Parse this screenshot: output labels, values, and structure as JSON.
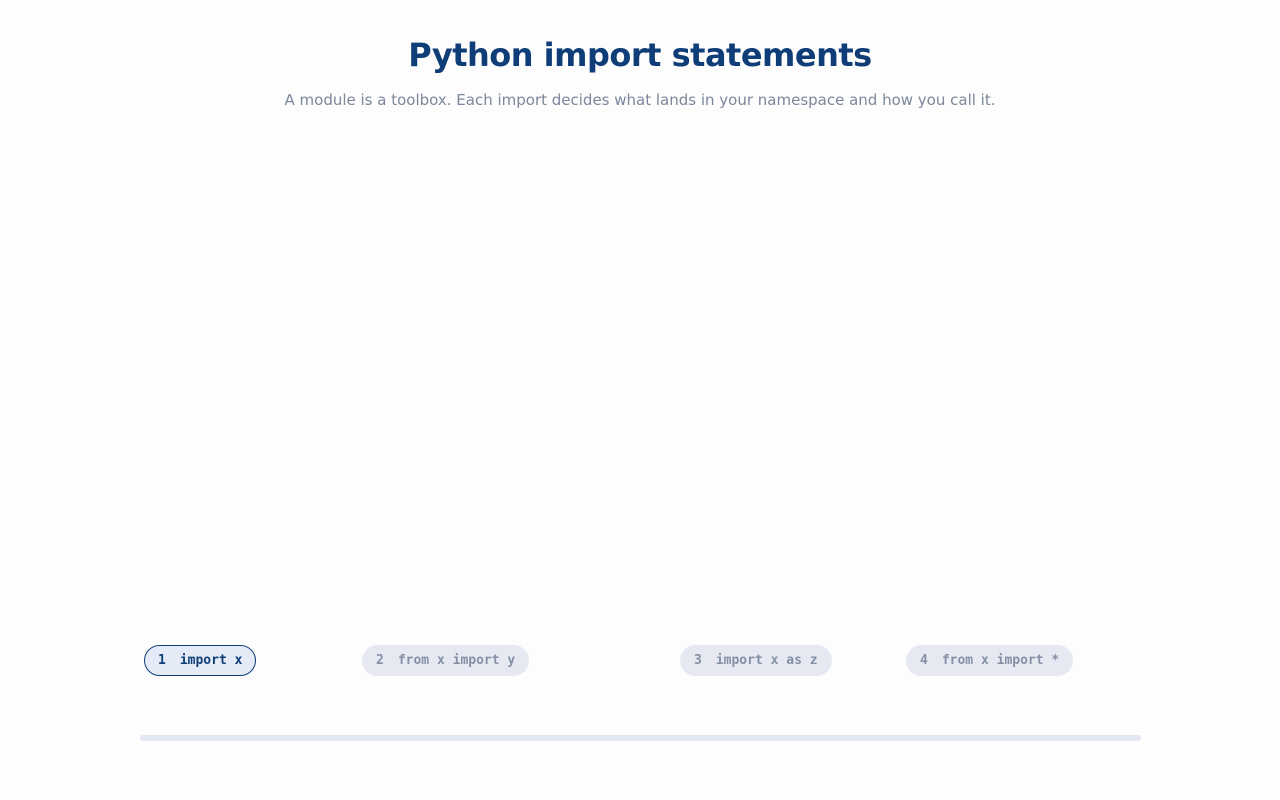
{
  "header": {
    "title": "Python import statements",
    "subtitle": "A module is a toolbox. Each import decides what lands in your namespace and how you call it."
  },
  "steps": [
    {
      "num": "1",
      "label": "import x",
      "active": true
    },
    {
      "num": "2",
      "label": "from x import y",
      "active": false
    },
    {
      "num": "3",
      "label": "import x as z",
      "active": false
    },
    {
      "num": "4",
      "label": "from x import *",
      "active": false
    }
  ],
  "progress": {
    "fraction": 0
  },
  "colors": {
    "accent": "#0e3d78",
    "muted_text": "#7c879b",
    "inactive_pill": "#e6e9f1",
    "track": "#e2e7f1"
  }
}
